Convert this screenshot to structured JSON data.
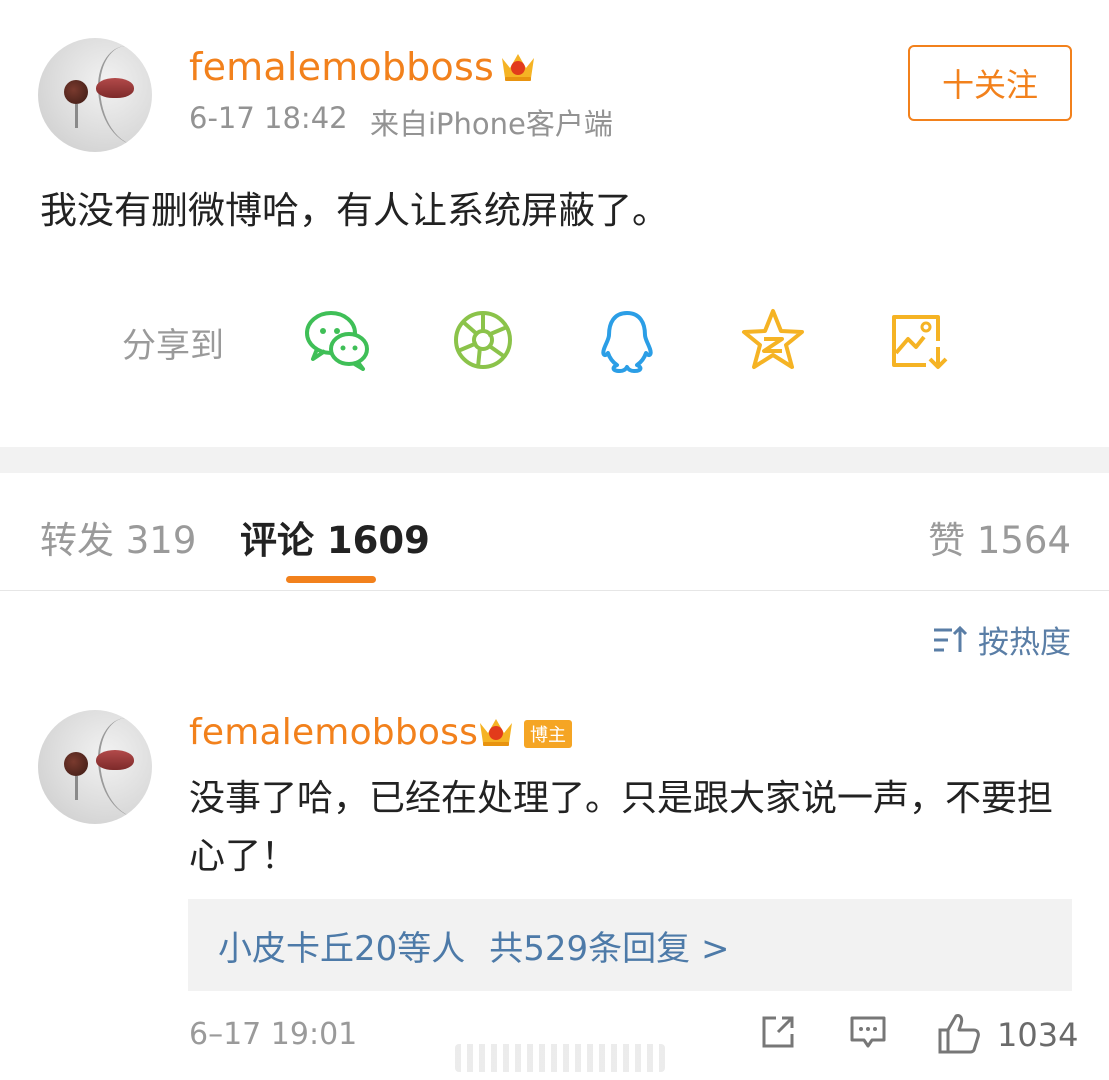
{
  "post": {
    "username": "femalemobboss",
    "time": "6-17 18:42",
    "source": "来自iPhone客户端",
    "follow_label": "十关注",
    "text": "我没有删微博哈，有人让系统屏蔽了。"
  },
  "share": {
    "label": "分享到",
    "icons": [
      "wechat-icon",
      "moments-icon",
      "qq-icon",
      "qzone-icon",
      "save-image-icon"
    ]
  },
  "tabs": {
    "repost_label": "转发 319",
    "comment_label": "评论 1609",
    "like_label": "赞 1564"
  },
  "sort": {
    "label": "按热度"
  },
  "comment": {
    "username": "femalemobboss",
    "badge": "博主",
    "text": "没事了哈，已经在处理了。只是跟大家说一声，不要担心了！",
    "reply_users": "小皮卡丘20等人",
    "reply_count": "共529条回复 >",
    "time": "6–17 19:01",
    "like_count": "1034"
  },
  "colors": {
    "accent": "#f2811c",
    "link": "#4d7aa8",
    "muted": "#9a9a9a"
  }
}
